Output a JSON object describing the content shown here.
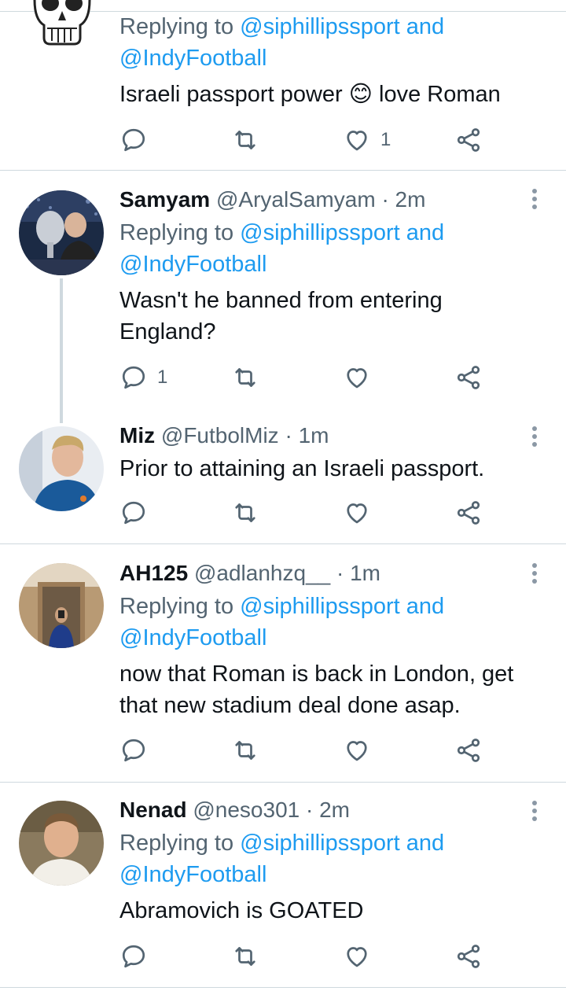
{
  "tweets": [
    {
      "name": "",
      "handle": "",
      "time": "",
      "replying_prefix": "Replying to",
      "mention1": "@siphillipssport",
      "and": "and",
      "mention2": "@IndyFootball",
      "text": "Israeli passport power",
      "emoji": "😊",
      "text_suffix": " love Roman",
      "reply_count": "",
      "retweet_count": "",
      "like_count": "1"
    },
    {
      "name": "Samyam",
      "handle": "@AryalSamyam",
      "dot": "·",
      "time": "2m",
      "replying_prefix": "Replying to",
      "mention1": "@siphillipssport",
      "and": "and",
      "mention2": "@IndyFootball",
      "text_line1": "Wasn't he banned from entering",
      "text_line2": "England?",
      "reply_count": "1",
      "like_count": ""
    },
    {
      "name": "Miz",
      "handle": "@FutbolMiz",
      "dot": "·",
      "time": "1m",
      "text": "Prior to attaining an Israeli passport."
    },
    {
      "name": "AH125",
      "handle": "@adlanhzq__",
      "dot": "·",
      "time": "1m",
      "replying_prefix": "Replying to",
      "mention1": "@siphillipssport",
      "and": "and",
      "mention2": "@IndyFootball",
      "text_line1": "now that Roman is back in London, get",
      "text_line2": "that new stadium deal done asap."
    },
    {
      "name": "Nenad",
      "handle": "@neso301",
      "dot": "·",
      "time": "2m",
      "replying_prefix": "Replying to",
      "mention1": "@siphillipssport",
      "and": "and",
      "mention2": "@IndyFootball",
      "text": "Abramovich is GOATED"
    }
  ],
  "icons": {
    "reply": "reply-icon",
    "retweet": "retweet-icon",
    "like": "like-icon",
    "share": "share-icon",
    "more": "more-options-icon"
  },
  "colors": {
    "link": "#1d9bf0",
    "secondary_text": "#536471",
    "divider": "#cfd9de",
    "icon": "#536471"
  }
}
